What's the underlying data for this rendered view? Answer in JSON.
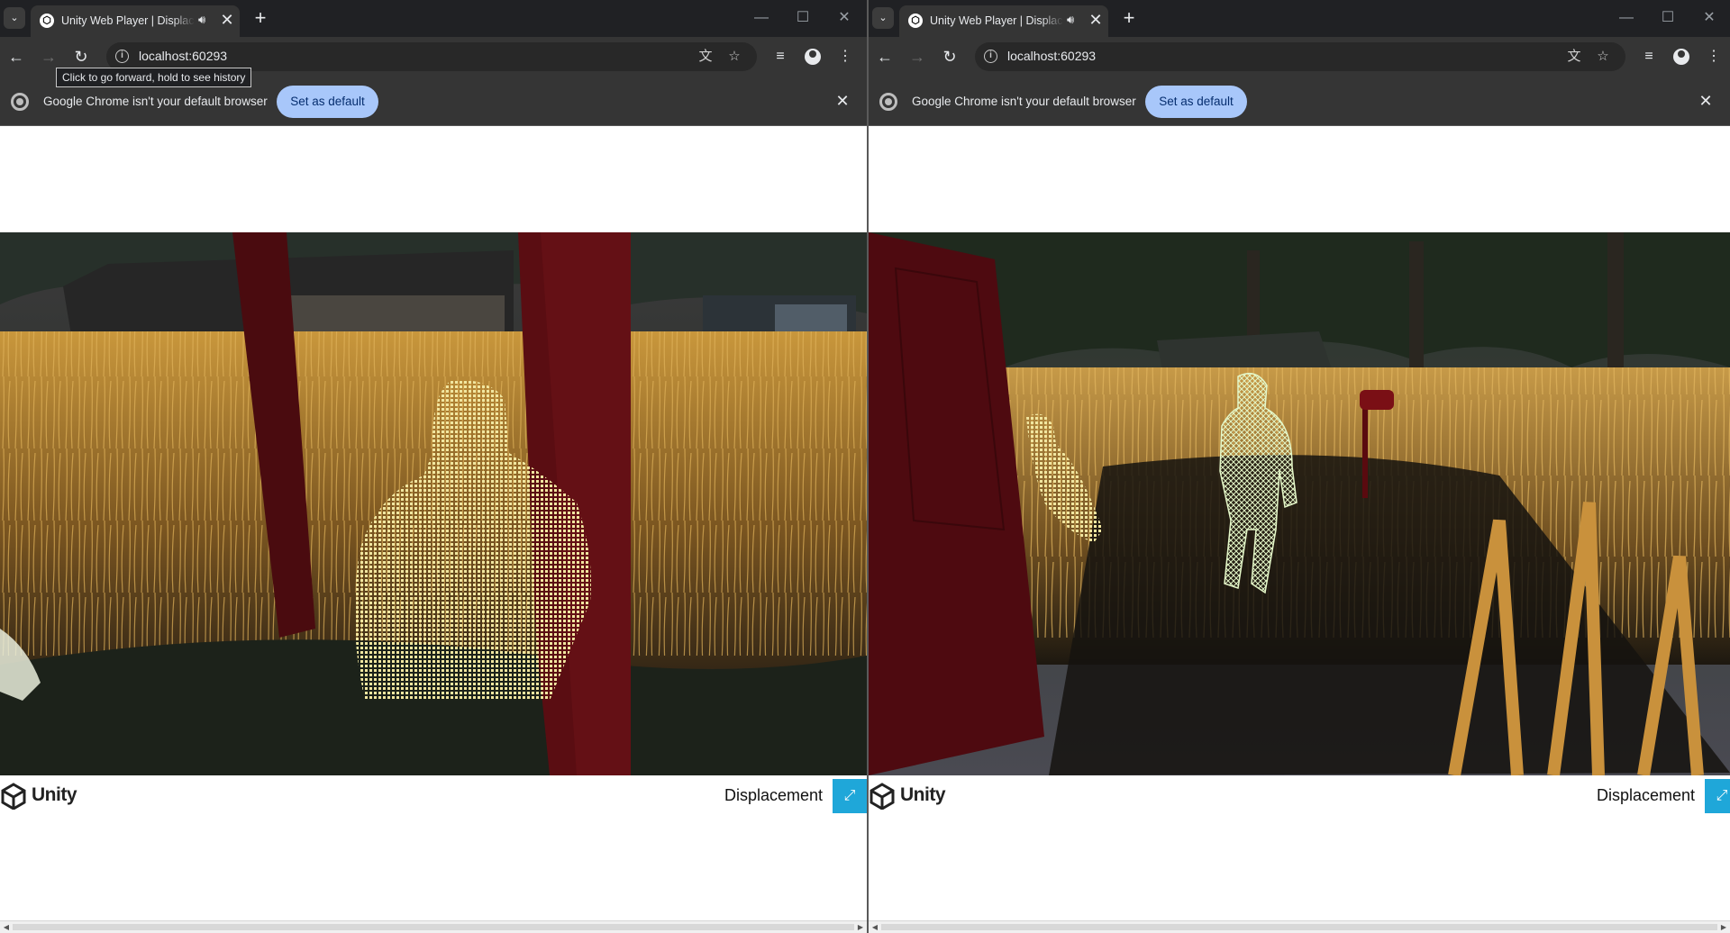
{
  "windows": [
    {
      "tab": {
        "title": "Unity Web Player | Displacement",
        "menu_icon": "chevron-down-icon",
        "audio_icon": "speaker-icon",
        "close_glyph": "✕",
        "new_tab_glyph": "+"
      },
      "window_controls": {
        "minimize": "—",
        "maximize": "☐",
        "close": "✕"
      },
      "toolbar": {
        "url": "localhost:60293"
      },
      "tooltip": "Click to go forward, hold to see history",
      "infobar": {
        "message": "Google Chrome isn't your default browser",
        "button_label": "Set as default",
        "close_glyph": "✕"
      },
      "unity_footer": {
        "logo_text": "Unity",
        "title": "Displacement",
        "fullscreen_icon": "expand-icon"
      },
      "scene": "Wheat field at dusk: glowing yellow voxel point-cloud bust of a person between a dark red post and a red door, shed and trees behind"
    },
    {
      "tab": {
        "title": "Unity Web Player | Displacement",
        "menu_icon": "chevron-down-icon",
        "audio_icon": "speaker-icon",
        "close_glyph": "✕",
        "new_tab_glyph": "+"
      },
      "window_controls": {
        "minimize": "—",
        "maximize": "☐",
        "close": "✕"
      },
      "toolbar": {
        "url": "localhost:60293"
      },
      "infobar": {
        "message": "Google Chrome isn't your default browser",
        "button_label": "Set as default",
        "close_glyph": "✕"
      },
      "unity_footer": {
        "logo_text": "Unity",
        "title": "Displacement",
        "fullscreen_icon": "expand-icon"
      },
      "scene": "Wheat field path: red door on the left, yellow voxel person beside it, glowing green wireframe humanoid figure and red mailbox, dark forest and shed behind"
    }
  ],
  "colors": {
    "chrome_dark": "#353535",
    "tab_strip": "#202124",
    "set_default_button": "#a8c7fa",
    "unity_fullscreen": "#1fa7d9",
    "voxel_yellow": "#efe49b",
    "wireframe_green": "#d8f2b8",
    "door_red": "#5a0d12",
    "wheat_gold": "#b8862f"
  }
}
